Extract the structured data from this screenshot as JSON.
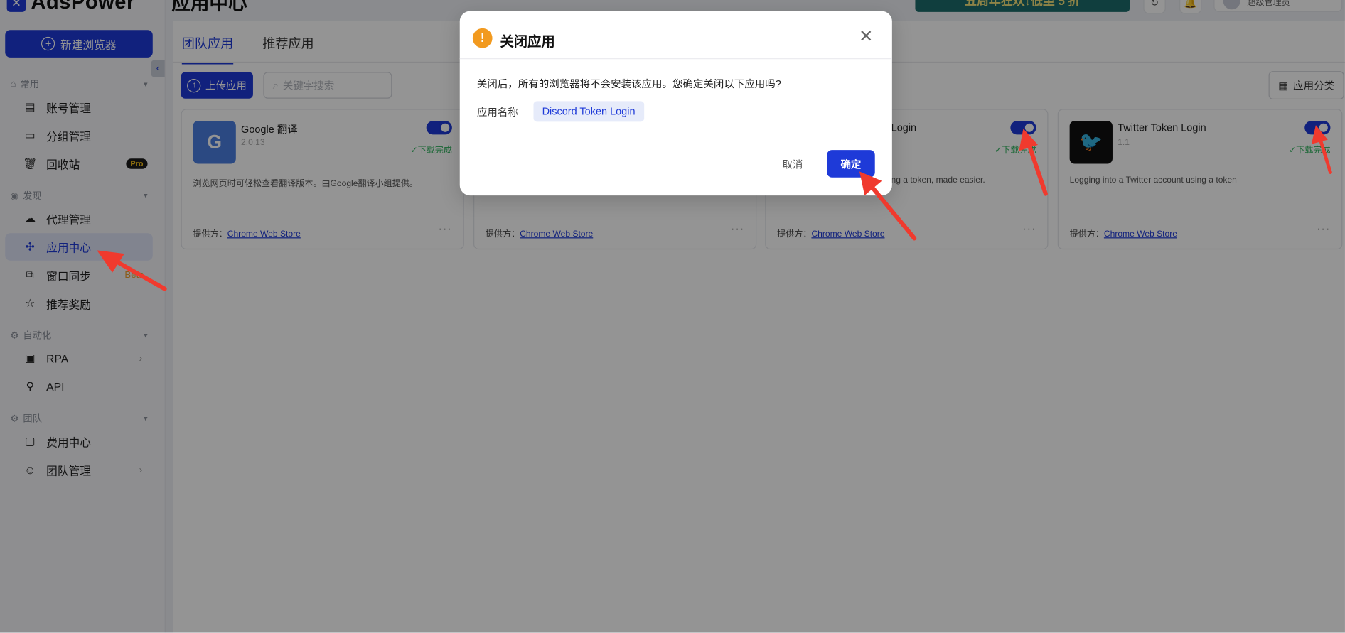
{
  "app": {
    "logo_text": "AdsPower",
    "page_title": "应用中心"
  },
  "colors": {
    "brand": "#1e3ad8",
    "success": "#2db15c",
    "warning": "#f29a1f",
    "annotation_arrow": "#f03a2e"
  },
  "sidebar": {
    "new_browser_label": "新建浏览器",
    "sections": {
      "common": "常用",
      "discover": "发现",
      "automation": "自动化",
      "team": "团队"
    },
    "items": [
      {
        "label": "账号管理",
        "icon": "folder-icon"
      },
      {
        "label": "分组管理",
        "icon": "folder-open-icon"
      },
      {
        "label": "回收站",
        "icon": "trash-icon",
        "badge": "Pro"
      },
      {
        "label": "代理管理",
        "icon": "proxy-icon"
      },
      {
        "label": "应用中心",
        "icon": "puzzle-icon",
        "active": true
      },
      {
        "label": "窗口同步",
        "icon": "sync-icon",
        "badge": "Beta"
      },
      {
        "label": "推荐奖励",
        "icon": "star-icon"
      },
      {
        "label": "RPA",
        "icon": "robot-icon"
      },
      {
        "label": "API",
        "icon": "plug-icon"
      },
      {
        "label": "费用中心",
        "icon": "wallet-icon"
      },
      {
        "label": "团队管理",
        "icon": "users-icon"
      }
    ]
  },
  "header": {
    "banner_text": "五周年狂欢↓低至 5 折",
    "user_role": "超级管理员"
  },
  "main": {
    "tabs": [
      {
        "label": "团队应用",
        "active": true
      },
      {
        "label": "推荐应用"
      }
    ],
    "upload_label": "上传应用",
    "search_placeholder": "关键字搜索",
    "category_label": "应用分类",
    "provider_prefix": "提供方：",
    "cards": [
      {
        "name": "Google 翻译",
        "version": "2.0.13",
        "status": "下载完成",
        "desc": "浏览网页时可轻松查看翻译版本。由Google翻译小组提供。",
        "provider": "Chrome Web Store"
      },
      {
        "name": "",
        "version": "",
        "status": "",
        "desc": "",
        "provider": "Chrome Web Store"
      },
      {
        "name": "Login",
        "version": "",
        "status": "下载完成",
        "desc": "nt using a token, made easier.",
        "provider": "Chrome Web Store"
      },
      {
        "name": "Twitter Token Login",
        "version": "1.1",
        "status": "下载完成",
        "desc": "Logging into a Twitter account using a token",
        "provider": "Chrome Web Store"
      }
    ]
  },
  "dialog": {
    "title": "关闭应用",
    "message": "关闭后，所有的浏览器将不会安装该应用。您确定关闭以下应用吗?",
    "app_name_label": "应用名称",
    "app_name_value": "Discord Token Login",
    "cancel_label": "取消",
    "confirm_label": "确定"
  }
}
